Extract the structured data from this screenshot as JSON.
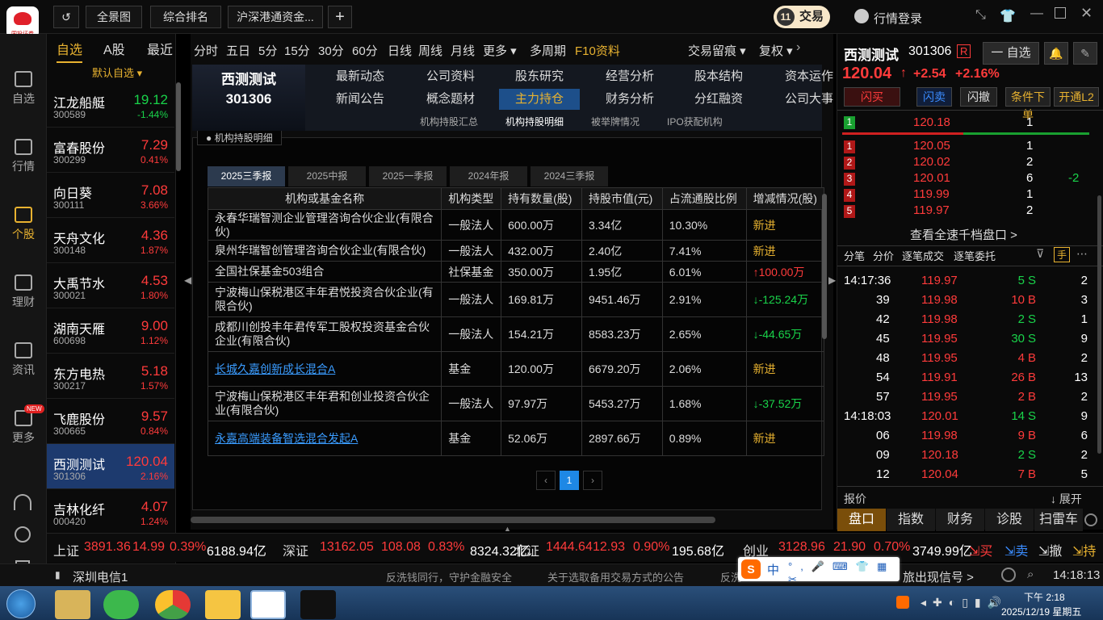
{
  "topbar": {
    "tabs": [
      "全景图",
      "综合排名",
      "沪深港通资金..."
    ],
    "plus": "+",
    "trade": "交易",
    "trade_icon": "11",
    "login": "行情登录",
    "logo_text": "国投证券"
  },
  "iconbar": [
    {
      "label": "自选"
    },
    {
      "label": "行情"
    },
    {
      "label": "个股"
    },
    {
      "label": "理财"
    },
    {
      "label": "资讯"
    },
    {
      "label": "更多",
      "badge": "NEW"
    }
  ],
  "watchlist": {
    "tabs": [
      "自选",
      "A股",
      "最近"
    ],
    "group": "默认自选",
    "items": [
      {
        "name": "江龙船艇",
        "code": "300589",
        "price": "19.12",
        "pct": "-1.44%",
        "dir": "down"
      },
      {
        "name": "富春股份",
        "code": "300299",
        "price": "7.29",
        "pct": "0.41%",
        "dir": "up"
      },
      {
        "name": "向日葵",
        "code": "300111",
        "price": "7.08",
        "pct": "3.66%",
        "dir": "up"
      },
      {
        "name": "天舟文化",
        "code": "300148",
        "price": "4.36",
        "pct": "1.87%",
        "dir": "up"
      },
      {
        "name": "大禹节水",
        "code": "300021",
        "price": "4.53",
        "pct": "1.80%",
        "dir": "up"
      },
      {
        "name": "湖南天雁",
        "code": "600698",
        "price": "9.00",
        "pct": "1.12%",
        "dir": "up"
      },
      {
        "name": "东方电热",
        "code": "300217",
        "price": "5.18",
        "pct": "1.57%",
        "dir": "up"
      },
      {
        "name": "飞鹿股份",
        "code": "300665",
        "price": "9.57",
        "pct": "0.84%",
        "dir": "up"
      },
      {
        "name": "西测测试",
        "code": "301306",
        "price": "120.04",
        "pct": "2.16%",
        "dir": "up"
      },
      {
        "name": "吉林化纤",
        "code": "000420",
        "price": "4.07",
        "pct": "1.24%",
        "dir": "up"
      }
    ]
  },
  "periods": [
    "分时",
    "五日",
    "5分",
    "15分",
    "30分",
    "60分",
    "日线",
    "周线",
    "月线",
    "更多 ▾",
    "多周期",
    "F10资料"
  ],
  "period_right": [
    "交易留痕 ▾",
    "复权 ▾"
  ],
  "f10": {
    "stock_name": "西测测试",
    "stock_code": "301306",
    "row1": [
      "最新动态",
      "公司资料",
      "股东研究",
      "经营分析",
      "股本结构",
      "资本运作"
    ],
    "row2": [
      "新闻公告",
      "概念题材",
      "主力持仓",
      "财务分析",
      "分红融资",
      "公司大事"
    ],
    "subtabs": [
      "机构持股汇总",
      "机构持股明细",
      "被举牌情况",
      "IPO获配机构"
    ],
    "section_title": "机构持股明细"
  },
  "quarters": [
    "2025三季报",
    "2025中报",
    "2025一季报",
    "2024年报",
    "2024三季报"
  ],
  "table": {
    "headers": [
      "机构或基金名称",
      "机构类型",
      "持有数量(股)",
      "持股市值(元)",
      "占流通股比例",
      "增减情况(股)"
    ],
    "rows": [
      {
        "name": "永春华瑞智测企业管理咨询合伙企业(有限合伙)",
        "type": "一般法人",
        "qty": "600.00万",
        "value": "3.34亿",
        "ratio": "10.30%",
        "chg": "新进",
        "chg_dir": "new",
        "link": false
      },
      {
        "name": "泉州华瑞智创管理咨询合伙企业(有限合伙)",
        "type": "一般法人",
        "qty": "432.00万",
        "value": "2.40亿",
        "ratio": "7.41%",
        "chg": "新进",
        "chg_dir": "new",
        "link": false
      },
      {
        "name": "全国社保基金503组合",
        "type": "社保基金",
        "qty": "350.00万",
        "value": "1.95亿",
        "ratio": "6.01%",
        "chg": "100.00万",
        "chg_dir": "up",
        "link": false
      },
      {
        "name": "宁波梅山保税港区丰年君悦投资合伙企业(有限合伙)",
        "type": "一般法人",
        "qty": "169.81万",
        "value": "9451.46万",
        "ratio": "2.91%",
        "chg": "-125.24万",
        "chg_dir": "down",
        "link": false
      },
      {
        "name": "成都川创投丰年君传军工股权投资基金合伙企业(有限合伙)",
        "type": "一般法人",
        "qty": "154.21万",
        "value": "8583.23万",
        "ratio": "2.65%",
        "chg": "-44.65万",
        "chg_dir": "down",
        "link": false
      },
      {
        "name": "长城久嘉创新成长混合A",
        "type": "基金",
        "qty": "120.00万",
        "value": "6679.20万",
        "ratio": "2.06%",
        "chg": "新进",
        "chg_dir": "new",
        "link": true
      },
      {
        "name": "宁波梅山保税港区丰年君和创业投资合伙企业(有限合伙)",
        "type": "一般法人",
        "qty": "97.97万",
        "value": "5453.27万",
        "ratio": "1.68%",
        "chg": "-37.52万",
        "chg_dir": "down",
        "link": false
      },
      {
        "name": "永嘉高端装备智选混合发起A",
        "type": "基金",
        "qty": "52.06万",
        "value": "2897.66万",
        "ratio": "0.89%",
        "chg": "新进",
        "chg_dir": "new",
        "link": true
      }
    ]
  },
  "pagination": {
    "prev": "‹",
    "page": "1",
    "next": "›"
  },
  "quote": {
    "name": "西测测试",
    "code": "301306",
    "tag": "R",
    "watch_btn": "一 自选",
    "price": "120.04",
    "chg": "+2.54",
    "pct": "+2.16%",
    "buttons": [
      "闪买",
      "闪卖",
      "闪撤",
      "条件下单",
      "开通L2"
    ],
    "bid1": {
      "lvl": "1",
      "price": "120.18",
      "vol": "1"
    },
    "asks": [
      {
        "lvl": "1",
        "price": "120.05",
        "vol": "1",
        "d": ""
      },
      {
        "lvl": "2",
        "price": "120.02",
        "vol": "2",
        "d": ""
      },
      {
        "lvl": "3",
        "price": "120.01",
        "vol": "6",
        "d": "-2"
      },
      {
        "lvl": "4",
        "price": "119.99",
        "vol": "1",
        "d": ""
      },
      {
        "lvl": "5",
        "price": "119.97",
        "vol": "2",
        "d": ""
      }
    ],
    "more": "查看全速千档盘口 >",
    "tick_tabs": [
      "分笔",
      "分价",
      "逐笔成交",
      "逐笔委托"
    ],
    "ticks": [
      {
        "t": "14:17:36",
        "p": "119.97",
        "v": "5",
        "s": "S",
        "n": "2"
      },
      {
        "t": "39",
        "p": "119.98",
        "v": "10",
        "s": "B",
        "n": "3"
      },
      {
        "t": "42",
        "p": "119.98",
        "v": "2",
        "s": "S",
        "n": "1"
      },
      {
        "t": "45",
        "p": "119.95",
        "v": "30",
        "s": "S",
        "n": "9"
      },
      {
        "t": "48",
        "p": "119.95",
        "v": "4",
        "s": "B",
        "n": "2"
      },
      {
        "t": "54",
        "p": "119.91",
        "v": "26",
        "s": "B",
        "n": "13"
      },
      {
        "t": "57",
        "p": "119.95",
        "v": "2",
        "s": "B",
        "n": "2"
      },
      {
        "t": "14:18:03",
        "p": "120.01",
        "v": "14",
        "s": "S",
        "n": "9"
      },
      {
        "t": "06",
        "p": "119.98",
        "v": "9",
        "s": "B",
        "n": "6"
      },
      {
        "t": "09",
        "p": "120.18",
        "v": "2",
        "s": "S",
        "n": "2"
      },
      {
        "t": "12",
        "p": "120.04",
        "v": "7",
        "s": "B",
        "n": "5"
      }
    ],
    "report": "报价",
    "expand": "展开",
    "bottom_tabs": [
      "盘口",
      "指数",
      "财务",
      "诊股",
      "扫雷车"
    ]
  },
  "indices": [
    {
      "name": "上证",
      "v": "3891.36",
      "c": "14.99",
      "p": "0.39%",
      "amt": "6188.94亿"
    },
    {
      "name": "深证",
      "v": "13162.05",
      "c": "108.08",
      "p": "0.83%",
      "amt": "8324.32亿"
    },
    {
      "name": "北证",
      "v": "1444.64",
      "c": "12.93",
      "p": "0.90%",
      "amt": "195.68亿"
    },
    {
      "name": "创业",
      "v": "3128.96",
      "c": "21.90",
      "p": "0.70%",
      "amt": "3749.99亿"
    }
  ],
  "index_actions": [
    "买",
    "卖",
    "撤",
    "持"
  ],
  "status": {
    "conn": "深圳电信1",
    "msg1": "反洗钱同行，守护金融安全",
    "msg2": "关于选取备用交易方式的公告",
    "msg3": "反洗",
    "msg4": "旅出现信号 >",
    "time": "14:18:13"
  },
  "taskbar": {
    "time": "下午 2:18",
    "date": "2025/12/19 星期五",
    "ime": "中"
  },
  "colors": {
    "up": "#ff3b3b",
    "down": "#19d34a",
    "accent": "#e8b230",
    "select": "#1d3a6e"
  }
}
